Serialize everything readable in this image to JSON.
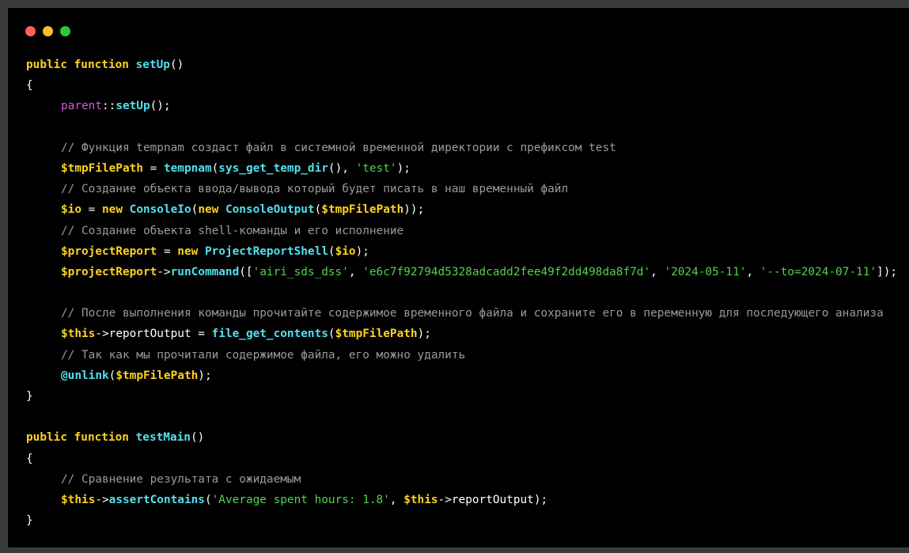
{
  "window": {
    "dots": [
      {
        "name": "close-dot",
        "color": "#ff5f57"
      },
      {
        "name": "minimize-dot",
        "color": "#febc2e"
      },
      {
        "name": "maximize-dot",
        "color": "#28c840"
      }
    ]
  },
  "code": {
    "l1": {
      "kw": "public function ",
      "fn": "setUp",
      "rest": "()"
    },
    "l2": "{",
    "l3": {
      "parent": "parent",
      "sep": "::",
      "fn": "setUp",
      "rest": "();"
    },
    "l5": "// Функция tempnam создаст файл в системной временной директории с префиксом test",
    "l6": {
      "var1": "$tmpFilePath",
      "eq": " = ",
      "fn1": "tempnam",
      "p1": "(",
      "fn2": "sys_get_temp_dir",
      "p2": "(), ",
      "str": "'test'",
      "p3": ");"
    },
    "l7": "// Создание объекта ввода/вывода который будет писать в наш временный файл",
    "l8": {
      "var1": "$io",
      "eq": " = ",
      "kw1": "new ",
      "fn1": "ConsoleIo",
      "p1": "(",
      "kw2": "new ",
      "fn2": "ConsoleOutput",
      "p2": "(",
      "var2": "$tmpFilePath",
      "p3": "));"
    },
    "l9": "// Создание объекта shell-команды и его исполнение",
    "l10": {
      "var1": "$projectReport",
      "eq": " = ",
      "kw1": "new ",
      "fn1": "ProjectReportShell",
      "p1": "(",
      "var2": "$io",
      "p2": ");"
    },
    "l11": {
      "var1": "$projectReport",
      "arrow": "->",
      "fn1": "runCommand",
      "p1": "([",
      "s1": "'airi_sds_dss'",
      "c1": ", ",
      "s2": "'e6c7f92794d5328adcadd2fee49f2dd498da8f7d'",
      "c2": ", ",
      "s3": "'2024-05-11'",
      "c3": ", ",
      "s4": "'--to=2024-07-11'",
      "p2": "]);"
    },
    "l13": "// После выполнения команды прочитайте содержимое временного файла и сохраните его в переменную для последующего анализа",
    "l14": {
      "var1": "$this",
      "arrow": "->",
      "prop": "reportOutput",
      "eq": " = ",
      "fn1": "file_get_contents",
      "p1": "(",
      "var2": "$tmpFilePath",
      "p2": ");"
    },
    "l15": "// Так как мы прочитали содержимое файла, его можно удалить",
    "l16": {
      "fn1": "@unlink",
      "p1": "(",
      "var1": "$tmpFilePath",
      "p2": ");"
    },
    "l17": "}",
    "l19": {
      "kw": "public function ",
      "fn": "testMain",
      "rest": "()"
    },
    "l20": "{",
    "l21": "// Сравнение результата с ожидаемым",
    "l22": {
      "var1": "$this",
      "arrow": "->",
      "fn1": "assertContains",
      "p1": "(",
      "str": "'Average spent hours: 1.8'",
      "c1": ", ",
      "var2": "$this",
      "arrow2": "->",
      "prop": "reportOutput",
      "p2": ");"
    },
    "l23": "}"
  }
}
